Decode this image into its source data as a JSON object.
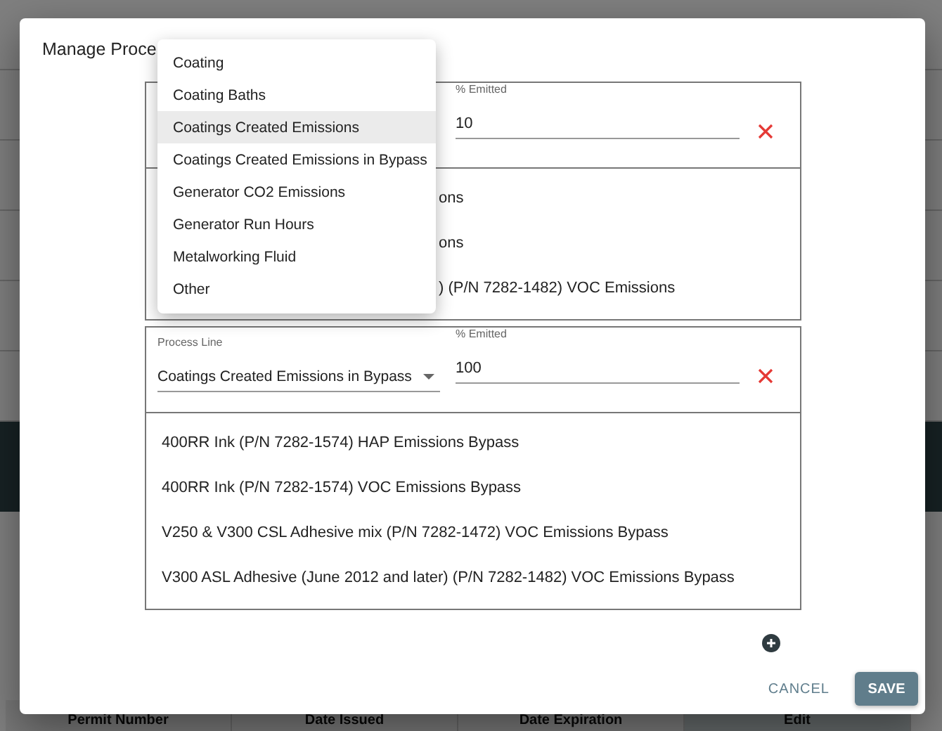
{
  "background_table": {
    "columns": [
      {
        "label": "Permit Number",
        "selected": false
      },
      {
        "label": "Date Issued",
        "selected": false
      },
      {
        "label": "Date Expiration",
        "selected": false
      },
      {
        "label": "Edit",
        "selected": true
      }
    ]
  },
  "dialog": {
    "title": "Manage Proce",
    "groups": [
      {
        "percent": {
          "label": "% Emitted",
          "value": "10"
        },
        "items": [
          "ons",
          "ons",
          ") (P/N 7282-1482) VOC Emissions"
        ]
      },
      {
        "process_line": {
          "label": "Process Line",
          "value": "Coatings Created Emissions in Bypass"
        },
        "percent": {
          "label": "% Emitted",
          "value": "100"
        },
        "items": [
          "400RR Ink (P/N 7282-1574) HAP Emissions Bypass",
          "400RR Ink (P/N 7282-1574) VOC Emissions Bypass",
          "V250 & V300 CSL Adhesive mix (P/N 7282-1472) VOC Emissions Bypass",
          "V300 ASL Adhesive (June 2012 and later) (P/N 7282-1482) VOC Emissions Bypass"
        ]
      }
    ],
    "menu": {
      "options": [
        {
          "label": "Coating",
          "selected": false
        },
        {
          "label": "Coating Baths",
          "selected": false
        },
        {
          "label": "Coatings Created Emissions",
          "selected": true
        },
        {
          "label": "Coatings Created Emissions in Bypass",
          "selected": false
        },
        {
          "label": "Generator CO2 Emissions",
          "selected": false
        },
        {
          "label": "Generator Run Hours",
          "selected": false
        },
        {
          "label": "Metalworking Fluid",
          "selected": false
        },
        {
          "label": "Other",
          "selected": false
        }
      ]
    },
    "cancel": "CANCEL",
    "save": "SAVE"
  }
}
